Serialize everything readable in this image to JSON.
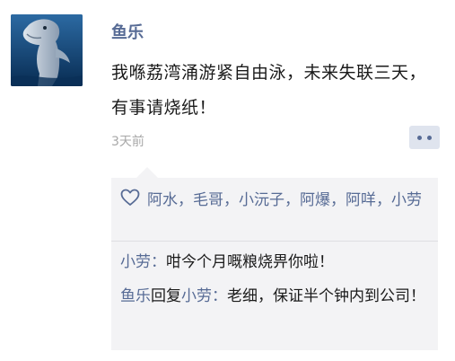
{
  "post": {
    "author": "鱼乐",
    "content": "我喺荔湾涌游紧自由泳，未来失联三天，有事请烧纸！",
    "time": "3天前",
    "colors": {
      "link": "#576b95",
      "text": "#1a1a1a",
      "time": "#a8a8a8",
      "panel": "#f3f3f5"
    }
  },
  "likes": {
    "icon": "heart-outline-icon",
    "names": [
      "阿水",
      "毛哥",
      "小沅子",
      "阿爆",
      "阿咩",
      "小劳"
    ],
    "separator": "，"
  },
  "comments": [
    {
      "author": "小劳",
      "colon": "：",
      "text": "咁今个月嘅粮烧畀你啦！"
    },
    {
      "author": "鱼乐",
      "reply_word": "回复",
      "reply_to": "小劳",
      "colon": "：",
      "text": "老细，保证半个钟内到公司！"
    }
  ],
  "icons": {
    "avatar": "dolphin-avatar",
    "comment_button": "more-dots-icon"
  }
}
